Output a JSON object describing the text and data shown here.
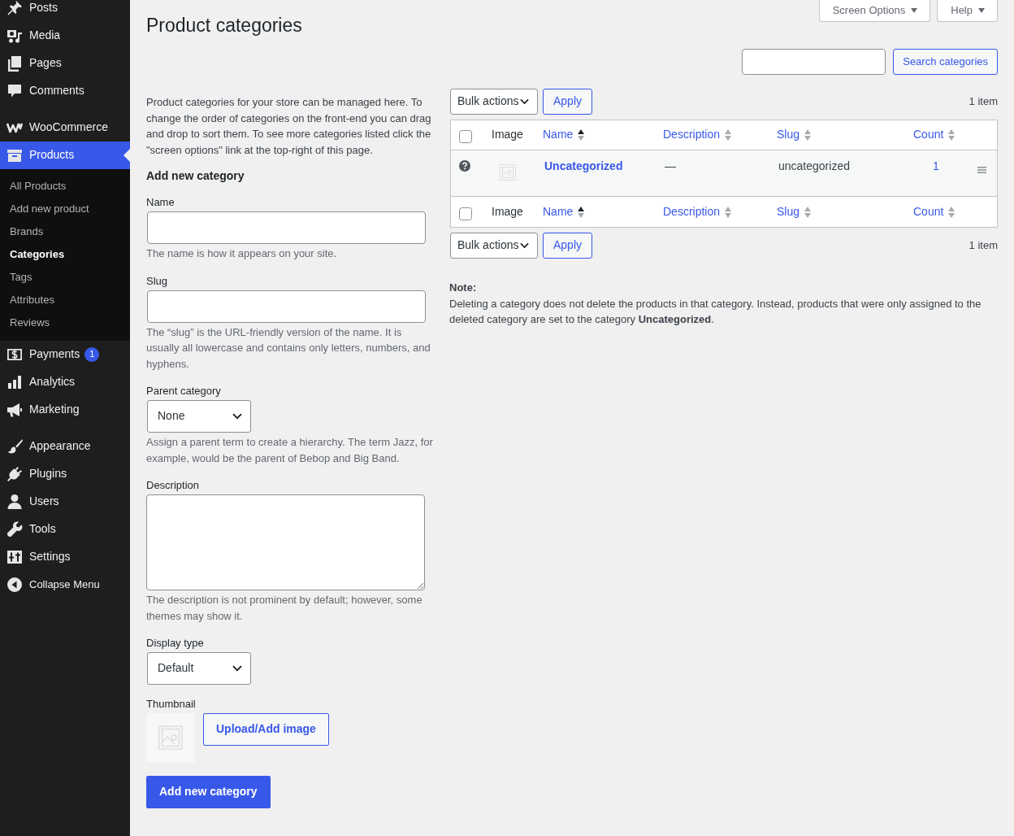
{
  "sidebar": {
    "sections": [
      {
        "items": [
          {
            "label": "Posts",
            "selected": false
          },
          {
            "label": "Media",
            "selected": false
          },
          {
            "label": "Pages",
            "selected": false
          },
          {
            "label": "Comments",
            "selected": false
          }
        ]
      },
      {
        "items": [
          {
            "label": "WooCommerce",
            "selected": false
          },
          {
            "label": "Products",
            "selected": true,
            "children": [
              {
                "label": "All Products",
                "selected": false
              },
              {
                "label": "Add new product",
                "selected": false
              },
              {
                "label": "Brands",
                "selected": false
              },
              {
                "label": "Categories",
                "selected": true
              },
              {
                "label": "Tags",
                "selected": false
              },
              {
                "label": "Attributes",
                "selected": false
              },
              {
                "label": "Reviews",
                "selected": false
              }
            ]
          },
          {
            "label": "Payments",
            "selected": false,
            "badge": "1"
          },
          {
            "label": "Analytics",
            "selected": false
          },
          {
            "label": "Marketing",
            "selected": false
          }
        ]
      },
      {
        "items": [
          {
            "label": "Appearance",
            "selected": false
          },
          {
            "label": "Plugins",
            "selected": false
          },
          {
            "label": "Users",
            "selected": false
          },
          {
            "label": "Tools",
            "selected": false
          },
          {
            "label": "Settings",
            "selected": false
          }
        ]
      }
    ],
    "collapse": "Collapse Menu"
  },
  "header": {
    "title": "Product categories",
    "tabs": [
      {
        "label": "Screen Options"
      },
      {
        "label": "Help"
      }
    ]
  },
  "search": {
    "button": "Search categories"
  },
  "intro": "Product categories for your store can be managed here. To change the order of categories on the front-end you can drag and drop to sort them. To see more categories listed click the \"screen options\" link at the top-right of this page.",
  "form": {
    "heading": "Add new category",
    "fields": [
      {
        "kind": "text",
        "label": "Name",
        "help": "The name is how it appears on your site."
      },
      {
        "kind": "text",
        "label": "Slug",
        "help": "The “slug” is the URL-friendly version of the name. It is usually all lowercase and contains only letters, numbers, and hyphens."
      },
      {
        "kind": "select",
        "label": "Parent category",
        "value": "None",
        "help": "Assign a parent term to create a hierarchy. The term Jazz, for example, would be the parent of Bebop and Big Band."
      },
      {
        "kind": "textarea",
        "label": "Description",
        "help": "The description is not prominent by default; however, some themes may show it."
      },
      {
        "kind": "select",
        "label": "Display type",
        "value": "Default"
      },
      {
        "kind": "thumbnail",
        "label": "Thumbnail",
        "button": "Upload/Add image"
      }
    ],
    "submit": "Add new category"
  },
  "list": {
    "top_bar": {
      "bulk": "Bulk actions",
      "apply": "Apply",
      "count": "1 item"
    },
    "table": {
      "header": {
        "checked": false,
        "columns": [
          {
            "label": "Image",
            "kind": "plain"
          },
          {
            "label": "Name",
            "kind": "sortable",
            "sorted": true
          },
          {
            "label": "Description",
            "kind": "sortable",
            "sorted": false
          },
          {
            "label": "Slug",
            "kind": "sortable",
            "sorted": false
          },
          {
            "label": "Count",
            "kind": "sortable",
            "sorted": false
          }
        ]
      },
      "rows": [
        {
          "name": "Uncategorized",
          "description": "—",
          "slug": "uncategorized",
          "count": "1"
        }
      ],
      "footer": {
        "checked": false,
        "columns": [
          {
            "label": "Image",
            "kind": "plain"
          },
          {
            "label": "Name",
            "kind": "sortable",
            "sorted": true
          },
          {
            "label": "Description",
            "kind": "sortable",
            "sorted": false
          },
          {
            "label": "Slug",
            "kind": "sortable",
            "sorted": false
          },
          {
            "label": "Count",
            "kind": "sortable",
            "sorted": false
          }
        ]
      }
    },
    "bottom_bar": {
      "bulk": "Bulk actions",
      "apply": "Apply",
      "count": "1 item"
    }
  },
  "note": {
    "label": "Note:",
    "text": "Deleting a category does not delete the products in that category. Instead, products that were only assigned to the deleted category are set to the category **Uncategorized**."
  }
}
